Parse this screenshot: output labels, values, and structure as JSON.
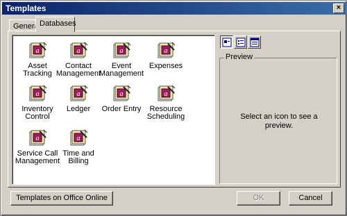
{
  "window": {
    "title": "Templates",
    "close_symbol": "×"
  },
  "tabs": [
    {
      "label": "General",
      "selected": false
    },
    {
      "label": "Databases",
      "selected": true
    }
  ],
  "templates": [
    {
      "label": "Asset Tracking"
    },
    {
      "label": "Contact Management"
    },
    {
      "label": "Event Management"
    },
    {
      "label": "Expenses"
    },
    {
      "label": "Inventory Control"
    },
    {
      "label": "Ledger"
    },
    {
      "label": "Order Entry"
    },
    {
      "label": "Resource Scheduling"
    },
    {
      "label": "Service Call Management"
    },
    {
      "label": "Time and Billing"
    }
  ],
  "view_buttons": [
    {
      "name": "large-icons",
      "selected": true
    },
    {
      "name": "list",
      "selected": false
    },
    {
      "name": "details",
      "selected": false
    }
  ],
  "preview": {
    "legend": "Preview",
    "message": "Select an icon to see a preview."
  },
  "buttons": {
    "online": "Templates on Office Online",
    "ok": "OK",
    "ok_enabled": false,
    "cancel": "Cancel"
  },
  "colors": {
    "titlebar_start": "#0a246a",
    "titlebar_end": "#3a6ea5",
    "icon_accent": "#9c1f5c"
  }
}
